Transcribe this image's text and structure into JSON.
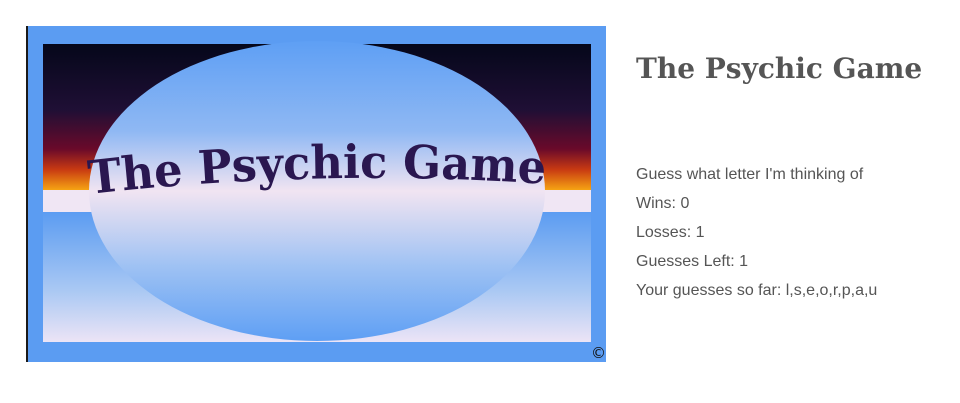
{
  "banner": {
    "title_art": "The Psychic Game",
    "copyright_mark": "©"
  },
  "header": {
    "title": "The Psychic Game"
  },
  "game": {
    "instruction": "Guess what letter I'm thinking of",
    "wins_label": "Wins: ",
    "wins": "0",
    "losses_label": "Losses: ",
    "losses": "1",
    "guesses_left_label": "Guesses Left: ",
    "guesses_left": "1",
    "guesses_so_far_label": "Your guesses so far: ",
    "guesses_so_far": "l,s,e,o,r,p,a,u"
  },
  "colors": {
    "text": "#555555",
    "banner_blue": "#5b9cf2",
    "banner_title": "#2a1750"
  }
}
